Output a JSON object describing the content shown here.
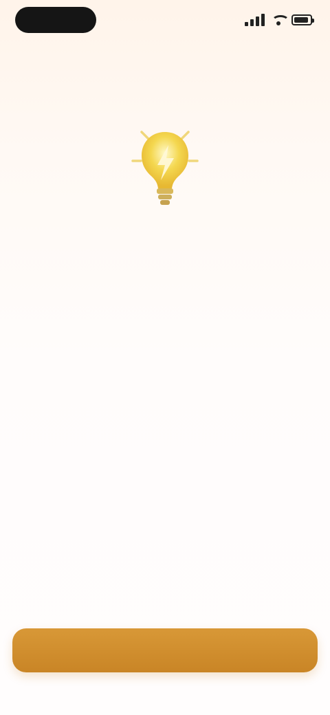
{
  "status_bar": {
    "time": "",
    "signal_icon": "signal-icon",
    "wifi_icon": "wifi-icon",
    "battery_icon": "battery-icon"
  },
  "hero": {
    "icon": "lightbulb-icon",
    "title": "",
    "paragraphs": [
      "",
      ""
    ]
  },
  "cta": {
    "label": ""
  },
  "colors": {
    "page_background": "#FFF9F4",
    "icon_yellow": "#F4D74F",
    "button_orange": "#D08A2B"
  }
}
